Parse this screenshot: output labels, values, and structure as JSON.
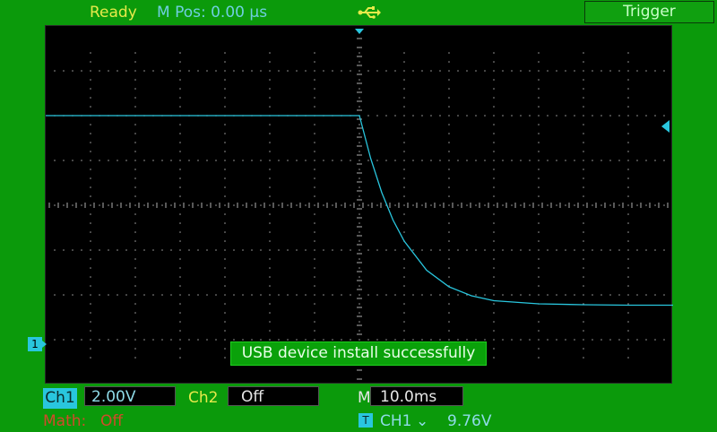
{
  "status": "Ready",
  "mpos": {
    "label": "M Pos:",
    "value": "0.00",
    "unit": "µs"
  },
  "usb": {
    "icon": "usb-icon"
  },
  "trigger_tab": "Trigger",
  "message": "USB device install successfully",
  "ch1": {
    "label": "Ch1",
    "marker": "1",
    "scale": "2.00V"
  },
  "ch2": {
    "label": "Ch2",
    "state": "Off"
  },
  "timebase": {
    "label": "M",
    "value": "10.0ms"
  },
  "math": {
    "label": "Math:",
    "state": "Off"
  },
  "trigger": {
    "badge": "T",
    "source": "CH1",
    "edge": "⌄",
    "level": "9.76V"
  },
  "colors": {
    "background": "#0b9a0b",
    "screen": "#000000",
    "ch1": "#29c6de",
    "status": "#e6ea4a",
    "math": "#d14a2a"
  },
  "chart_data": {
    "type": "line",
    "x_divisions": 14,
    "y_divisions": 8,
    "ylim": [
      -4,
      4
    ],
    "xlim": [
      -7,
      7
    ],
    "series": [
      {
        "color": "#29c6de",
        "x": [
          -7,
          0,
          0.25,
          0.5,
          0.75,
          1,
          1.5,
          2,
          2.5,
          3,
          4,
          5,
          6,
          7
        ],
        "y": [
          2.0,
          2.0,
          1.05,
          0.28,
          -0.33,
          -0.8,
          -1.45,
          -1.82,
          -2.02,
          -2.13,
          -2.2,
          -2.22,
          -2.23,
          -2.23
        ]
      }
    ]
  }
}
